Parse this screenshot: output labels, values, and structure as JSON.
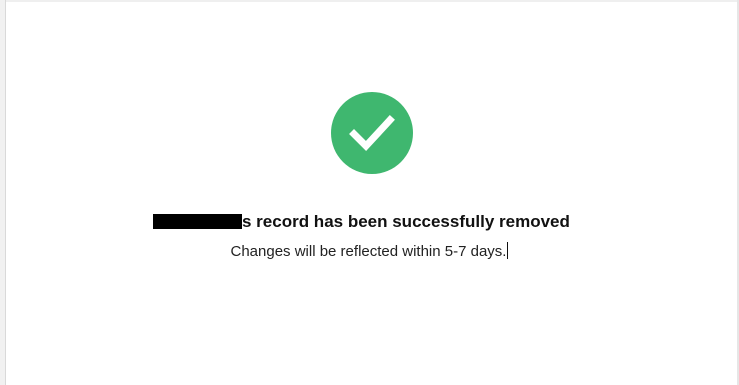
{
  "confirmation": {
    "headline_suffix": "s record has been successfully removed",
    "message": "Changes will be reflected within 5-7 days."
  },
  "colors": {
    "success_green": "#3fb76f",
    "text": "#111111"
  },
  "icons": {
    "status": "checkmark-icon"
  }
}
